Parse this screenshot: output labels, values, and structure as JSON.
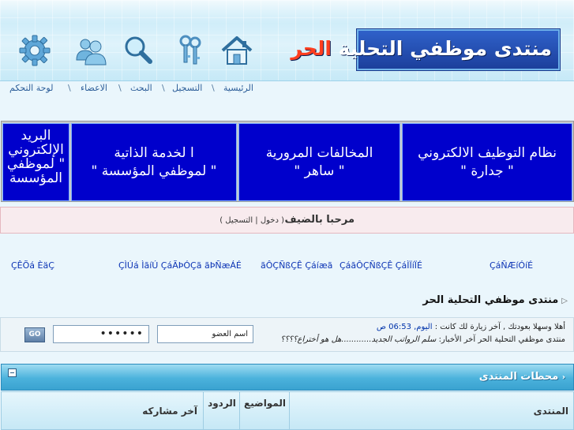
{
  "header": {
    "logo_prefix": "منتدى موظفي التحلية ",
    "logo_accent": "الحر"
  },
  "nav": {
    "home": "الرئيسية",
    "register": "التسجيل",
    "search": "البحث",
    "members": "الاعضاء",
    "control_panel": "لوحة التحكم",
    "separator": "\\"
  },
  "banners": [
    {
      "line1": "نظام التوظيف الالكتروني",
      "line2": "\" جدارة \""
    },
    {
      "line1": "المخالفات المرورية",
      "line2": "\" ساهر \""
    },
    {
      "line1": "ا لخدمة الذاتية",
      "line2": "\" لموظفي المؤسسة \""
    },
    {
      "line1": "البريد الإلكتروني",
      "line2": "\" لموظفي المؤسسة"
    }
  ],
  "welcome": {
    "title": "مرحبا بالضيف",
    "login": "دخول",
    "register": "التسجيل"
  },
  "links_row": [
    "ÇáÑÆíÓíÉ",
    "ãÔÇÑßÇÊ Çáíæã",
    "ÇáãÔÇÑßÇÊ ÇáÌÏíÏÉ",
    "ÇÌÚá ÌãíÚ ÇáÃÞÓÇã ãÞÑæÁÉ",
    "ÇÊÕá ÈäÇ"
  ],
  "breadcrumb": "منتدى موظفي التحلية الحر",
  "login_box": {
    "welcome_back": "أهلا وسهلا بعودتك , آخر زيارة لك كانت :",
    "last_visit": "اليوم, 06:53 ص",
    "news_prefix": "منتدى موظفي التحلية الحر آخر الأخبار:",
    "news_item": "سلم الرواتب الجديد............هل هو أختراع؟؟؟؟",
    "username_placeholder": "اسم العضو",
    "password_value": "••••••",
    "go_label": "GO"
  },
  "forum": {
    "section_title": "محطات المنتدى",
    "col_forum": "المنتدى",
    "col_topics": "المواضيع",
    "col_replies": "الردود",
    "col_last_post": "آخر مشاركه"
  },
  "colors": {
    "banner_bg": "#0000cc",
    "logo_bg": "#1c3f9c",
    "logo_accent": "#ff3e1f",
    "section_header": "#3aa2d0",
    "link_blue": "#0d35b5"
  }
}
